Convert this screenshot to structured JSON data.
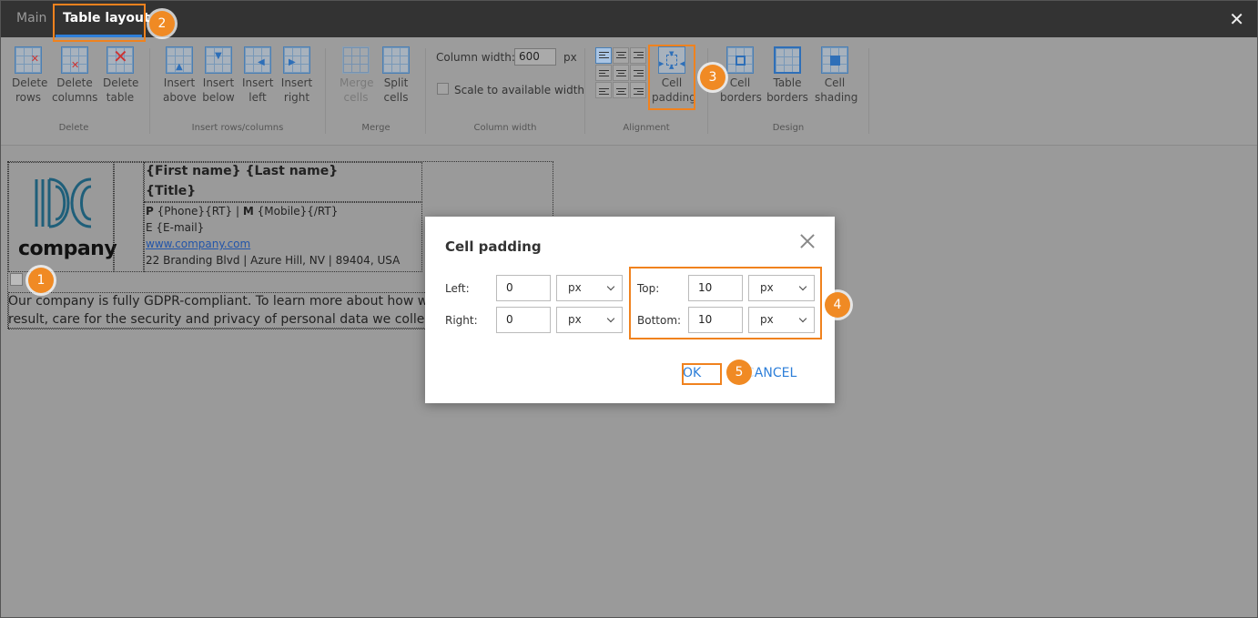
{
  "tabs": [
    {
      "label": "Main"
    },
    {
      "label": "Table layout"
    }
  ],
  "ribbon": {
    "groups": {
      "delete": "Delete",
      "insert": "Insert rows/columns",
      "merge": "Merge",
      "column_width": "Column width",
      "alignment": "Alignment",
      "design": "Design"
    },
    "buttons": {
      "delete_rows": [
        "Delete",
        "rows"
      ],
      "delete_columns": [
        "Delete",
        "columns"
      ],
      "delete_table": [
        "Delete",
        "table"
      ],
      "insert_above": [
        "Insert",
        "above"
      ],
      "insert_below": [
        "Insert",
        "below"
      ],
      "insert_left": [
        "Insert",
        "left"
      ],
      "insert_right": [
        "Insert",
        "right"
      ],
      "merge_cells": [
        "Merge",
        "cells"
      ],
      "split_cells": [
        "Split",
        "cells"
      ],
      "cell_padding": [
        "Cell",
        "padding"
      ],
      "cell_borders": [
        "Cell",
        "borders"
      ],
      "table_borders": [
        "Table",
        "borders"
      ],
      "cell_shading": [
        "Cell",
        "shading"
      ]
    },
    "column_width": {
      "label": "Column width:",
      "value": "600",
      "unit": "px",
      "scale_label": "Scale to available width"
    }
  },
  "signature": {
    "logo_text": "company",
    "name": "{First name} {Last name}",
    "title": "{Title}",
    "phone_prefix": "P",
    "phone": "{Phone}{RT}",
    "sep": "|",
    "mobile_prefix": "M",
    "mobile": "{Mobile}{/RT}",
    "email_prefix": "E",
    "email": "{E-mail}",
    "website": "www.company.com",
    "address": "22 Branding Blvd | Azure Hill, NV | 89404, USA",
    "disclaimer_1": "Our company is fully GDPR-compliant. To learn more about how we comply w",
    "disclaimer_2": "result, care for the security and privacy of personal data we collected from you"
  },
  "dialog": {
    "title": "Cell padding",
    "left_label": "Left:",
    "left_value": "0",
    "left_unit": "px",
    "right_label": "Right:",
    "right_value": "0",
    "right_unit": "px",
    "top_label": "Top:",
    "top_value": "10",
    "top_unit": "px",
    "bottom_label": "Bottom:",
    "bottom_value": "10",
    "bottom_unit": "px",
    "ok": "OK",
    "cancel": "CANCEL"
  },
  "callouts": [
    "1",
    "2",
    "3",
    "4",
    "5"
  ],
  "colors": {
    "accent": "#2e7fd9",
    "highlight": "#f0821e",
    "badge": "#f08a24",
    "topbar": "#333333"
  }
}
